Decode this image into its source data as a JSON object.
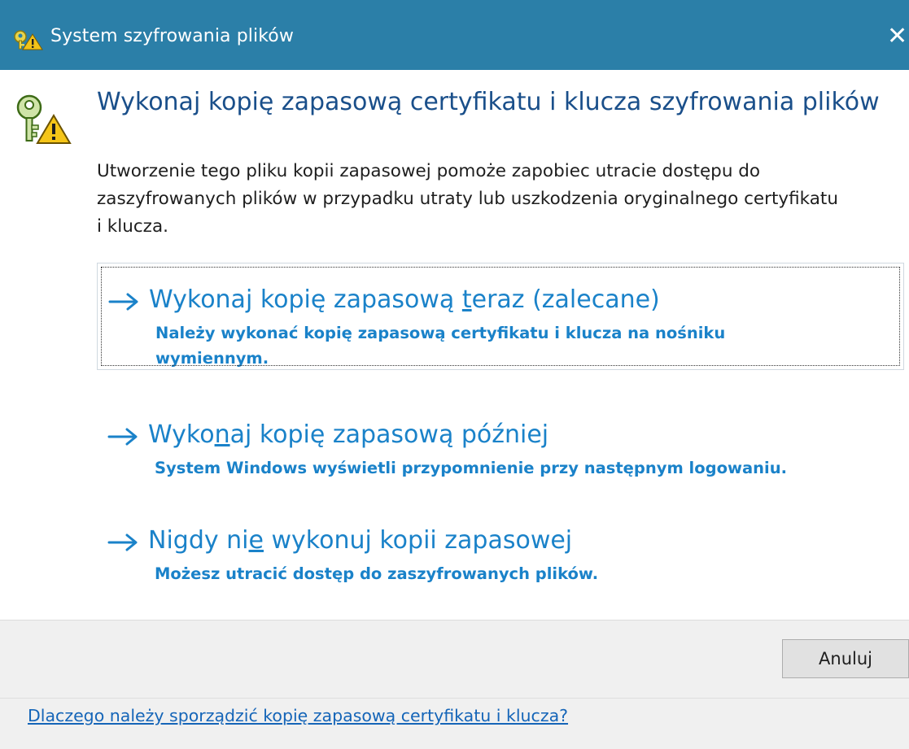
{
  "window": {
    "title": "System szyfrowania plików",
    "close_glyph": "✕",
    "titlebar_color": "#2b7fa8"
  },
  "header": {
    "title": "Wykonaj kopię zapasową certyfikatu i klucza szyfrowania plików",
    "icon": "key-warning-icon"
  },
  "description": {
    "line1": "Utworzenie tego pliku kopii zapasowej pomoże zapobiec utracie dostępu do",
    "line2": "zaszyfrowanych plików w przypadku utraty lub uszkodzenia oryginalnego certyfikatu",
    "line3": "i klucza."
  },
  "options": [
    {
      "title_before": "Wykonaj kopię zapasową ",
      "title_accel": "t",
      "title_after": "eraz (zalecane)",
      "desc_line1": "Należy wykonać kopię zapasową certyfikatu i klucza na nośniku",
      "desc_line2": "wymiennym.",
      "focused": true
    },
    {
      "title_before": "Wyko",
      "title_accel": "n",
      "title_after": "aj kopię zapasową później",
      "desc_line1": "System Windows wyświetli przypomnienie przy następnym logowaniu."
    },
    {
      "title_before": "Nigdy ni",
      "title_accel": "e",
      "title_after": " wykonuj kopii zapasowej",
      "desc_line1": "Możesz utracić dostęp do zaszyfrowanych plików."
    }
  ],
  "footer": {
    "cancel_label": "Anuluj",
    "help_link": "Dlaczego należy sporządzić kopię zapasową certyfikatu i klucza?"
  },
  "colors": {
    "accent": "#1a82c9",
    "header": "#1a4f8a",
    "link": "#1565b8"
  }
}
